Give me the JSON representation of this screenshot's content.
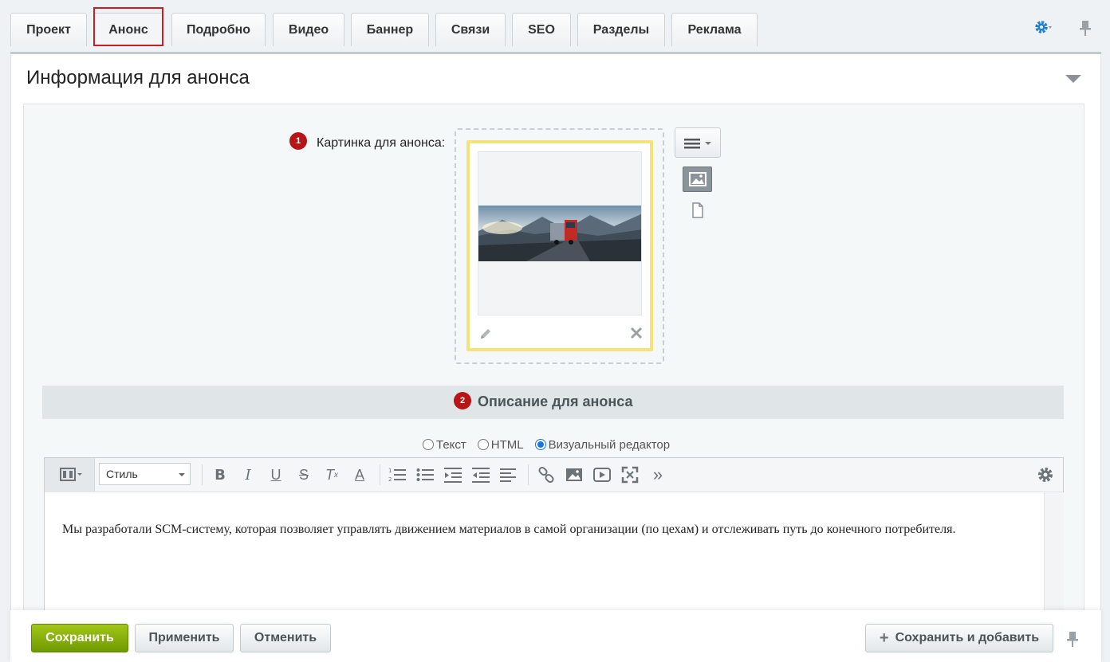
{
  "tabs": [
    {
      "label": "Проект"
    },
    {
      "label": "Анонс"
    },
    {
      "label": "Подробно"
    },
    {
      "label": "Видео"
    },
    {
      "label": "Баннер"
    },
    {
      "label": "Связи"
    },
    {
      "label": "SEO"
    },
    {
      "label": "Разделы"
    },
    {
      "label": "Реклама"
    }
  ],
  "active_tab": "Анонс",
  "section": {
    "title": "Информация для анонса"
  },
  "preview_image": {
    "badge": "1",
    "label": "Картинка для анонса:"
  },
  "description": {
    "badge": "2",
    "title": "Описание для анонса",
    "modes": [
      "Текст",
      "HTML",
      "Визуальный редактор"
    ],
    "selected_mode": "Визуальный редактор",
    "style_select": "Стиль",
    "content": "Мы разработали SCM-систему, которая позволяет управлять движением материалов в самой организации (по цехам) и отслеживать путь до конечного потребителя."
  },
  "footer": {
    "save": "Сохранить",
    "apply": "Применить",
    "cancel": "Отменить",
    "save_and_add": "Сохранить и добавить"
  },
  "colors": {
    "accent_red": "#c81f27",
    "save_green": "#8ab31a",
    "image_border_yellow": "#f6e27a"
  },
  "icons": {
    "settings": "gear-icon",
    "pin": "pin-icon",
    "collapse": "triangle-down-icon"
  }
}
